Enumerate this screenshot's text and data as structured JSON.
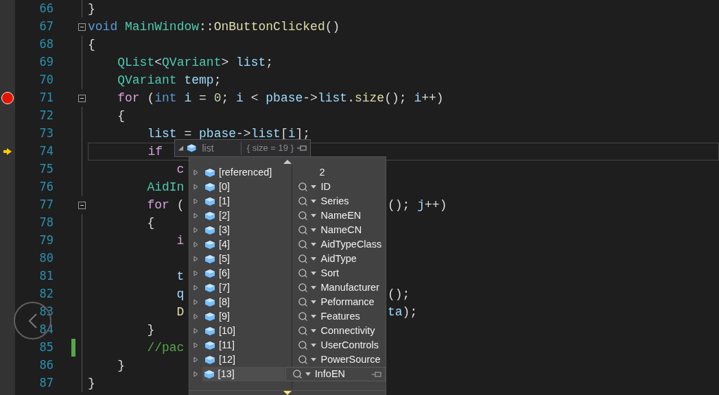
{
  "editor": {
    "lines": [
      {
        "number": "66",
        "breakpoint": false,
        "current": false,
        "changed": false,
        "fold": false,
        "tokens": [
          {
            "text": "}",
            "kind": "punct"
          }
        ]
      },
      {
        "number": "67",
        "breakpoint": false,
        "current": false,
        "changed": false,
        "fold": true,
        "tokens": [
          {
            "text": "void",
            "kind": "keyword"
          },
          {
            "text": " MainWindow",
            "kind": "type"
          },
          {
            "text": "::",
            "kind": "punct"
          },
          {
            "text": "OnButtonClicked",
            "kind": "function"
          },
          {
            "text": "()",
            "kind": "punct"
          }
        ]
      },
      {
        "number": "68",
        "breakpoint": false,
        "current": false,
        "changed": false,
        "fold": false,
        "tokens": [
          {
            "text": "{",
            "kind": "punct"
          }
        ]
      },
      {
        "number": "69",
        "breakpoint": false,
        "current": false,
        "changed": false,
        "fold": false,
        "tokens": [
          {
            "text": "    QList",
            "kind": "type"
          },
          {
            "text": "<",
            "kind": "punct"
          },
          {
            "text": "QVariant",
            "kind": "type"
          },
          {
            "text": "> ",
            "kind": "punct"
          },
          {
            "text": "list",
            "kind": "variable"
          },
          {
            "text": ";",
            "kind": "punct"
          }
        ]
      },
      {
        "number": "70",
        "breakpoint": false,
        "current": false,
        "changed": false,
        "fold": false,
        "tokens": [
          {
            "text": "    QVariant",
            "kind": "type"
          },
          {
            "text": " temp",
            "kind": "variable"
          },
          {
            "text": ";",
            "kind": "punct"
          }
        ]
      },
      {
        "number": "71",
        "breakpoint": true,
        "current": false,
        "changed": false,
        "fold": true,
        "tokens": [
          {
            "text": "    for",
            "kind": "control"
          },
          {
            "text": " (",
            "kind": "punct"
          },
          {
            "text": "int",
            "kind": "keyword"
          },
          {
            "text": " i",
            "kind": "variable"
          },
          {
            "text": " = ",
            "kind": "punct"
          },
          {
            "text": "0",
            "kind": "number"
          },
          {
            "text": "; ",
            "kind": "punct"
          },
          {
            "text": "i",
            "kind": "variable"
          },
          {
            "text": " < ",
            "kind": "punct"
          },
          {
            "text": "pbase",
            "kind": "variable"
          },
          {
            "text": "->",
            "kind": "punct"
          },
          {
            "text": "list",
            "kind": "variable"
          },
          {
            "text": ".",
            "kind": "punct"
          },
          {
            "text": "size",
            "kind": "function"
          },
          {
            "text": "(); ",
            "kind": "punct"
          },
          {
            "text": "i",
            "kind": "variable"
          },
          {
            "text": "++)",
            "kind": "punct"
          }
        ]
      },
      {
        "number": "72",
        "breakpoint": false,
        "current": false,
        "changed": false,
        "fold": false,
        "tokens": [
          {
            "text": "    {",
            "kind": "punct"
          }
        ]
      },
      {
        "number": "73",
        "breakpoint": false,
        "current": false,
        "changed": false,
        "fold": false,
        "tokens": [
          {
            "text": "        list",
            "kind": "variable"
          },
          {
            "text": " = ",
            "kind": "punct"
          },
          {
            "text": "pbase",
            "kind": "variable"
          },
          {
            "text": "->",
            "kind": "punct"
          },
          {
            "text": "list",
            "kind": "variable"
          },
          {
            "text": "[",
            "kind": "punct"
          },
          {
            "text": "i",
            "kind": "variable"
          },
          {
            "text": "];",
            "kind": "punct"
          }
        ]
      },
      {
        "number": "74",
        "breakpoint": false,
        "current": true,
        "changed": false,
        "fold": false,
        "tokens": [
          {
            "text": "        if",
            "kind": "control"
          }
        ]
      },
      {
        "number": "75",
        "breakpoint": false,
        "current": false,
        "changed": false,
        "fold": false,
        "tokens": [
          {
            "text": "            c",
            "kind": "control"
          }
        ]
      },
      {
        "number": "76",
        "breakpoint": false,
        "current": false,
        "changed": false,
        "fold": false,
        "tokens": [
          {
            "text": "        AidIn",
            "kind": "type"
          }
        ]
      },
      {
        "number": "77",
        "breakpoint": false,
        "current": false,
        "changed": false,
        "fold": true,
        "tokens": [
          {
            "text": "        for",
            "kind": "control"
          },
          {
            "text": " (",
            "kind": "punct"
          }
        ],
        "tail": [
          {
            "text": "(); ",
            "kind": "punct"
          },
          {
            "text": "j",
            "kind": "variable"
          },
          {
            "text": "++)",
            "kind": "punct"
          }
        ]
      },
      {
        "number": "78",
        "breakpoint": false,
        "current": false,
        "changed": false,
        "fold": false,
        "tokens": [
          {
            "text": "        {",
            "kind": "punct"
          }
        ]
      },
      {
        "number": "79",
        "breakpoint": false,
        "current": false,
        "changed": false,
        "fold": false,
        "tokens": [
          {
            "text": "            i",
            "kind": "control"
          }
        ]
      },
      {
        "number": "80",
        "breakpoint": false,
        "current": false,
        "changed": false,
        "fold": false
      },
      {
        "number": "81",
        "breakpoint": false,
        "current": false,
        "changed": false,
        "fold": false,
        "tokens": [
          {
            "text": "            t",
            "kind": "variable"
          }
        ]
      },
      {
        "number": "82",
        "breakpoint": false,
        "current": false,
        "changed": false,
        "fold": false,
        "tokens": [
          {
            "text": "            q",
            "kind": "variable"
          }
        ],
        "tail": [
          {
            "text": "();",
            "kind": "punct"
          }
        ]
      },
      {
        "number": "83",
        "breakpoint": false,
        "current": false,
        "changed": false,
        "fold": false,
        "tokens": [
          {
            "text": "            D",
            "kind": "function"
          }
        ],
        "tail": [
          {
            "text": "ta",
            "kind": "variable"
          },
          {
            "text": ");",
            "kind": "punct"
          }
        ]
      },
      {
        "number": "84",
        "breakpoint": false,
        "current": false,
        "changed": false,
        "fold": false,
        "tokens": [
          {
            "text": "        }",
            "kind": "punct"
          }
        ]
      },
      {
        "number": "85",
        "breakpoint": false,
        "current": false,
        "changed": true,
        "fold": false,
        "tokens": [
          {
            "text": "        //pac",
            "kind": "comment"
          }
        ]
      },
      {
        "number": "86",
        "breakpoint": false,
        "current": false,
        "changed": false,
        "fold": false,
        "tokens": [
          {
            "text": "    }",
            "kind": "punct"
          }
        ]
      },
      {
        "number": "87",
        "breakpoint": false,
        "current": false,
        "changed": false,
        "fold": false,
        "tokens": [
          {
            "text": "}",
            "kind": "punct"
          }
        ]
      }
    ]
  },
  "datatip": {
    "name": "list",
    "value": "{ size = 19 }",
    "rows": [
      {
        "name": "[referenced]",
        "value": "2",
        "kind": "plain",
        "selected": false
      },
      {
        "name": "[0]",
        "value": "ID",
        "kind": "visualizer",
        "selected": false
      },
      {
        "name": "[1]",
        "value": "Series",
        "kind": "visualizer",
        "selected": false
      },
      {
        "name": "[2]",
        "value": "NameEN",
        "kind": "visualizer",
        "selected": false
      },
      {
        "name": "[3]",
        "value": "NameCN",
        "kind": "visualizer",
        "selected": false
      },
      {
        "name": "[4]",
        "value": "AidTypeClass",
        "kind": "visualizer",
        "selected": false
      },
      {
        "name": "[5]",
        "value": "AidType",
        "kind": "visualizer",
        "selected": false
      },
      {
        "name": "[6]",
        "value": "Sort",
        "kind": "visualizer",
        "selected": false
      },
      {
        "name": "[7]",
        "value": "Manufacturer",
        "kind": "visualizer",
        "selected": false
      },
      {
        "name": "[8]",
        "value": "Peformance",
        "kind": "visualizer",
        "selected": false
      },
      {
        "name": "[9]",
        "value": "Features",
        "kind": "visualizer",
        "selected": false
      },
      {
        "name": "[10]",
        "value": "Connectivity",
        "kind": "visualizer",
        "selected": false
      },
      {
        "name": "[11]",
        "value": "UserControls",
        "kind": "visualizer",
        "selected": false
      },
      {
        "name": "[12]",
        "value": "PowerSource",
        "kind": "visualizer",
        "selected": false
      },
      {
        "name": "[13]",
        "value": "InfoEN",
        "kind": "visualizer",
        "selected": true
      }
    ]
  }
}
